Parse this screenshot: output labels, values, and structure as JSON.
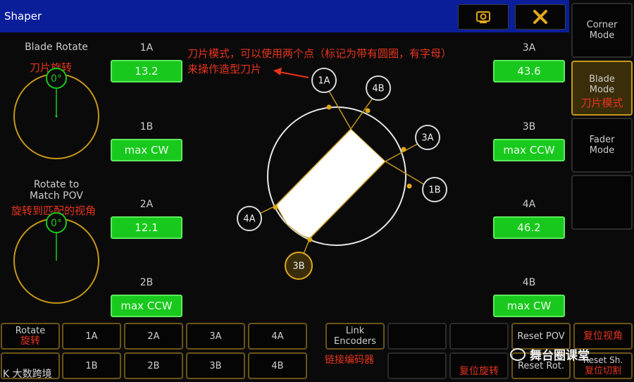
{
  "window": {
    "title": "Shaper"
  },
  "sidebar": {
    "corner_mode": "Corner Mode",
    "blade_mode": "Blade Mode",
    "blade_mode_ann": "刀片模式",
    "fader_mode": "Fader Mode"
  },
  "left": {
    "blade_rotate_label": "Blade Rotate",
    "blade_rotate_ann": "刀片旋转",
    "blade_rotate_value": "0°",
    "rotate_pov_label_1": "Rotate to",
    "rotate_pov_label_2": "Match POV",
    "rotate_pov_ann": "旋转到匹配的视角",
    "rotate_pov_value": "0°"
  },
  "fields": {
    "f1a": {
      "label": "1A",
      "value": "13.2"
    },
    "f1b": {
      "label": "1B",
      "value": "max CW"
    },
    "f2a": {
      "label": "2A",
      "value": "12.1"
    },
    "f2b": {
      "label": "2B",
      "value": "max CCW"
    },
    "f3a": {
      "label": "3A",
      "value": "43.6"
    },
    "f3b": {
      "label": "3B",
      "value": "max CCW"
    },
    "f4a": {
      "label": "4A",
      "value": "46.2"
    },
    "f4b": {
      "label": "4B",
      "value": "max CW"
    }
  },
  "annotation": {
    "line1": "刀片模式，可以使用两个点（标记为带有圆圈，有字母）",
    "line2": "来操作造型刀片"
  },
  "diagram_points": {
    "p1a": "1A",
    "p4b": "4B",
    "p3a": "3A",
    "p1b": "1B",
    "p4a": "4A",
    "p3b": "3B"
  },
  "bottom": {
    "rotate": "Rotate",
    "rotate_ann": "旋转",
    "row1": [
      "1A",
      "2A",
      "3A",
      "4A"
    ],
    "row2": [
      "1B",
      "2B",
      "3B",
      "4B"
    ],
    "link_encoders": "Link Encoders",
    "link_ann": "链接编码器",
    "reset_pov": "Reset POV",
    "reset_pov_ann": "复位视角",
    "reset_rot": "Reset Rot.",
    "reset_rot_ann": "复位旋转",
    "reset_sh": "Reset Sh.",
    "reset_sh_ann": "复位切割"
  },
  "watermark": {
    "brand": "舞台圈课堂",
    "corner": "K 大数跨境"
  },
  "colors": {
    "title_bar": "#0a1e9a",
    "field_green": "#19c81d",
    "accent": "#e0a81a",
    "annotation": "#e8341e"
  }
}
